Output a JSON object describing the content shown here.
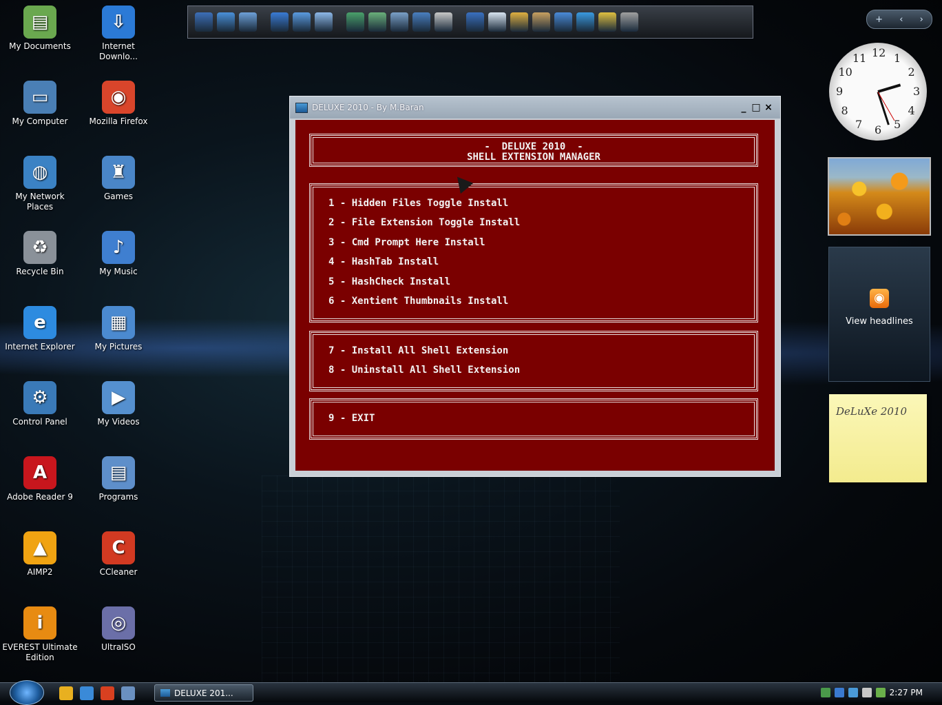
{
  "desktop_icons": [
    {
      "label": "My Documents",
      "icon": "folder-icon",
      "color": "#6aa84f"
    },
    {
      "label": "Internet\nDownlo...",
      "icon": "download-manager-icon",
      "color": "#2b7ad6"
    },
    {
      "label": "My Computer",
      "icon": "computer-icon",
      "color": "#4a7fb5"
    },
    {
      "label": "Mozilla Firefox",
      "icon": "firefox-icon",
      "color": "#d9452b"
    },
    {
      "label": "My Network\nPlaces",
      "icon": "globe-icon",
      "color": "#3b82c4"
    },
    {
      "label": "Games",
      "icon": "games-folder-icon",
      "color": "#4a86c8"
    },
    {
      "label": "Recycle Bin",
      "icon": "recycle-bin-icon",
      "color": "#8a9199"
    },
    {
      "label": "My Music",
      "icon": "music-folder-icon",
      "color": "#3f7fd0"
    },
    {
      "label": "Internet Explorer",
      "icon": "internet-explorer-icon",
      "color": "#2d8be0"
    },
    {
      "label": "My Pictures",
      "icon": "pictures-folder-icon",
      "color": "#4b8ad0"
    },
    {
      "label": "Control Panel",
      "icon": "control-panel-icon",
      "color": "#3a7ab8"
    },
    {
      "label": "My Videos",
      "icon": "videos-folder-icon",
      "color": "#5590cf"
    },
    {
      "label": "Adobe Reader 9",
      "icon": "adobe-reader-icon",
      "color": "#c8161d"
    },
    {
      "label": "Programs",
      "icon": "programs-folder-icon",
      "color": "#5e8fca"
    },
    {
      "label": "AIMP2",
      "icon": "aimp-icon",
      "color": "#f0a312"
    },
    {
      "label": "CCleaner",
      "icon": "ccleaner-icon",
      "color": "#d23a22"
    },
    {
      "label": "EVEREST Ultimate\nEdition",
      "icon": "everest-icon",
      "color": "#e88b12"
    },
    {
      "label": "UltraISO",
      "icon": "ultraiso-icon",
      "color": "#6b6fa8"
    }
  ],
  "dock": {
    "icons": [
      "system-icon",
      "globe-icon",
      "shield-icon",
      "word-icon",
      "document-icon",
      "mail-icon",
      "picture-icon",
      "photo-gallery-icon",
      "screen-icon",
      "computer-icon",
      "tool-icon",
      "monitor-icon",
      "notepad-icon",
      "image-icon",
      "cow-icon",
      "users-icon",
      "ie-icon",
      "plane-icon",
      "lock-icon"
    ],
    "colors": [
      "#3d6fb8",
      "#4a90d9",
      "#6da0d8",
      "#3a7bd5",
      "#5a9be0",
      "#8db8e8",
      "#4aa06a",
      "#6ab07a",
      "#7aa0c8",
      "#4a7fc0",
      "#c8c8c8",
      "#3a70c0",
      "#d8e4f0",
      "#e0b040",
      "#c8a060",
      "#4a8ad8",
      "#3a9ae0",
      "#e0c040",
      "#a0a0a0"
    ]
  },
  "sidebar": {
    "controls": {
      "add": "+",
      "prev": "‹",
      "next": "›"
    },
    "clock": {
      "numbers": [
        "12",
        "1",
        "2",
        "3",
        "4",
        "5",
        "6",
        "7",
        "8",
        "9",
        "10",
        "11"
      ],
      "time_hours": 2,
      "time_minutes": 27
    },
    "feed": {
      "label": "View headlines"
    },
    "note": {
      "text": "DeLuXe 2010"
    }
  },
  "window": {
    "title": "DELUXE 2010 - By M.Baran",
    "controls": {
      "minimize": "_",
      "maximize": "□",
      "close": "×"
    },
    "header_line1": "-  DELUXE 2010  -",
    "header_line2": "SHELL EXTENSION MANAGER",
    "menu_group1": [
      "1 - Hidden Files Toggle Install",
      "2 - File Extension Toggle Install",
      "3 - Cmd Prompt Here Install",
      "4 - HashTab Install",
      "5 - HashCheck Install",
      "6 - Xentient Thumbnails Install"
    ],
    "menu_group2": [
      "7 - Install All Shell Extension",
      "8 - Uninstall All Shell Extension"
    ],
    "menu_group3": [
      "9 - EXIT"
    ]
  },
  "taskbar": {
    "task_label": "DELUXE 201...",
    "quicklaunch_colors": [
      "#e8b020",
      "#3a8ad8",
      "#d84020",
      "#6a90c0"
    ],
    "tray_colors": [
      "#4a9a4a",
      "#3a7ad0",
      "#4a9ad8",
      "#c8c8c8",
      "#6ab04a"
    ],
    "time": "2:27 PM"
  }
}
